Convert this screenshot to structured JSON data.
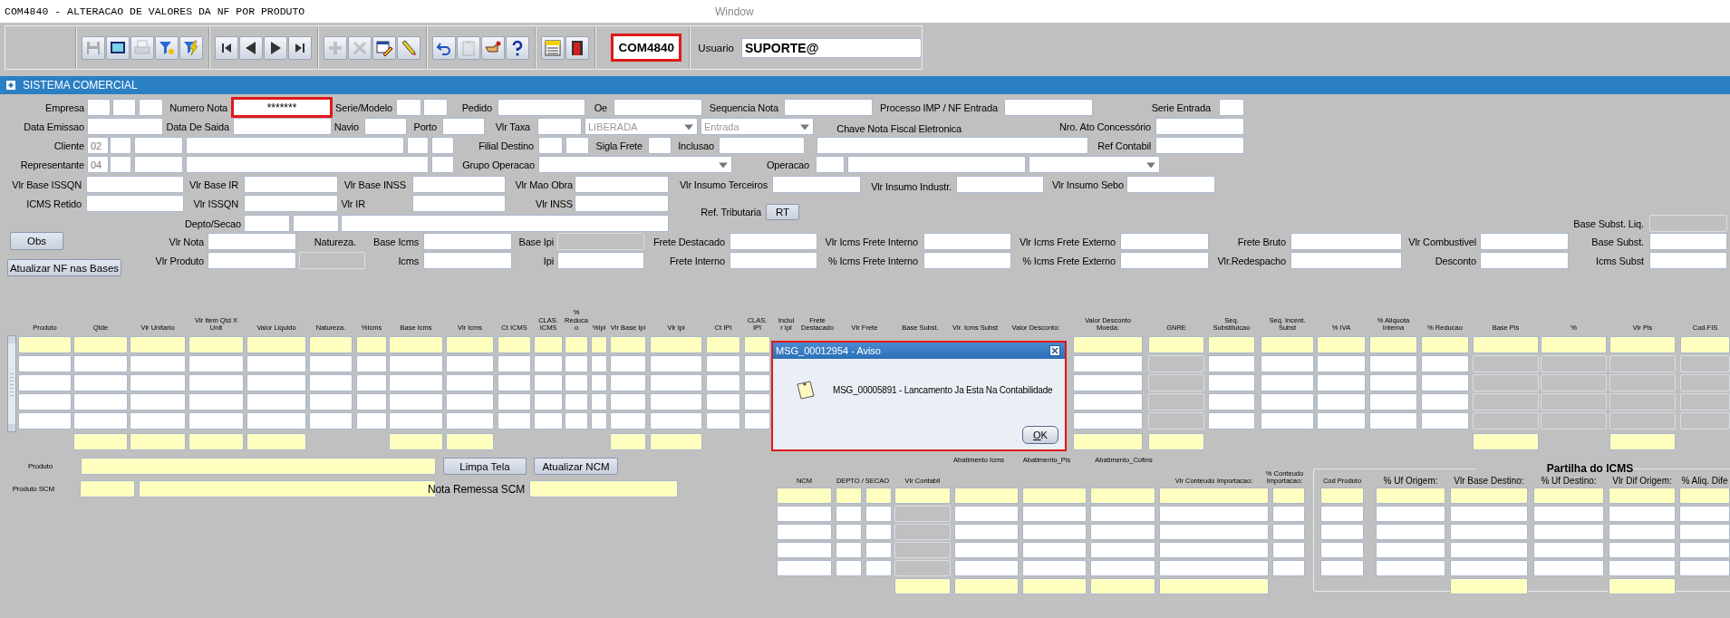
{
  "window": {
    "title": "COM4840 - ALTERACAO DE VALORES DA NF POR PRODUTO",
    "menu": "Window"
  },
  "toolbar": {
    "groups": [
      [
        {
          "kind": "save",
          "disabled": true
        },
        {
          "kind": "window",
          "disabled": false
        },
        {
          "kind": "print",
          "disabled": true
        },
        {
          "kind": "query",
          "disabled": false
        },
        {
          "kind": "execute",
          "disabled": false
        }
      ],
      [
        {
          "kind": "first",
          "disabled": false
        },
        {
          "kind": "prev",
          "disabled": false
        },
        {
          "kind": "next",
          "disabled": false
        },
        {
          "kind": "last",
          "disabled": false
        }
      ],
      [
        {
          "kind": "insert",
          "disabled": true
        },
        {
          "kind": "delete",
          "disabled": true
        },
        {
          "kind": "edit",
          "disabled": false
        },
        {
          "kind": "clear",
          "disabled": false
        }
      ],
      [
        {
          "kind": "undo",
          "disabled": false
        },
        {
          "kind": "clipboard",
          "disabled": true
        },
        {
          "kind": "hand",
          "disabled": false
        },
        {
          "kind": "help",
          "disabled": false
        }
      ],
      [
        {
          "kind": "menu",
          "disabled": false
        },
        {
          "kind": "exit",
          "disabled": false
        }
      ]
    ],
    "form_code": "COM4840",
    "user_label": "Usuario",
    "user": "SUPORTE@"
  },
  "panel": {
    "title": "SISTEMA COMERCIAL"
  },
  "form": {
    "rows": [
      {
        "items": [
          {
            "kind": "label",
            "text": "Empresa"
          },
          {
            "kind": "field",
            "disabled": false
          },
          {
            "kind": "field",
            "disabled": false
          },
          {
            "kind": "field",
            "disabled": false
          },
          {
            "kind": "label",
            "text": "Numero Nota"
          },
          {
            "kind": "field",
            "value": "*******",
            "disabled": false,
            "highlighted": true
          },
          {
            "kind": "label",
            "text": "Serie/Modelo"
          },
          {
            "kind": "field",
            "disabled": false
          },
          {
            "kind": "field",
            "disabled": false
          },
          {
            "kind": "label",
            "text": "Pedido"
          },
          {
            "kind": "field",
            "disabled": false
          },
          {
            "kind": "label",
            "text": "Oe"
          },
          {
            "kind": "field",
            "disabled": false
          },
          {
            "kind": "label",
            "text": "Sequencia Nota"
          },
          {
            "kind": "field",
            "disabled": false
          },
          {
            "kind": "label",
            "text": "Processo IMP / NF Entrada"
          },
          {
            "kind": "field",
            "disabled": false
          },
          {
            "kind": "label",
            "text": "Serie Entrada"
          },
          {
            "kind": "field",
            "disabled": false
          }
        ]
      },
      {
        "items": [
          {
            "kind": "label",
            "text": "Data Emissao"
          },
          {
            "kind": "field",
            "disabled": false
          },
          {
            "kind": "label",
            "text": "Data De Saida"
          },
          {
            "kind": "field",
            "disabled": false
          },
          {
            "kind": "label",
            "text": "Navio"
          },
          {
            "kind": "field",
            "disabled": false
          },
          {
            "kind": "label",
            "text": "Porto"
          },
          {
            "kind": "field",
            "disabled": false
          },
          {
            "kind": "label",
            "text": "Vlr Taxa"
          },
          {
            "kind": "field",
            "disabled": false
          },
          {
            "kind": "select",
            "value": "LIBERADA",
            "disabled": true
          },
          {
            "kind": "select",
            "value": "Entrada",
            "disabled": true
          },
          {
            "kind": "label",
            "text": "Chave Nota Fiscal Eletronica"
          },
          {
            "kind": "label",
            "text": "Nro. Ato Concessório"
          },
          {
            "kind": "field",
            "disabled": false
          }
        ]
      },
      {
        "items": [
          {
            "kind": "label",
            "text": "Cliente"
          },
          {
            "kind": "field",
            "value": "02",
            "disabled": false,
            "readonly": true
          },
          {
            "kind": "field",
            "disabled": false
          },
          {
            "kind": "field",
            "disabled": false
          },
          {
            "kind": "field",
            "disabled": false
          },
          {
            "kind": "field",
            "disabled": false
          },
          {
            "kind": "field",
            "disabled": false
          },
          {
            "kind": "label",
            "text": "Filial Destino"
          },
          {
            "kind": "field",
            "disabled": false
          },
          {
            "kind": "field",
            "disabled": false
          },
          {
            "kind": "label",
            "text": "Sigla Frete"
          },
          {
            "kind": "field",
            "disabled": false
          },
          {
            "kind": "label",
            "text": "Inclusao"
          },
          {
            "kind": "field",
            "disabled": false
          },
          {
            "kind": "field",
            "disabled": false
          },
          {
            "kind": "label",
            "text": "Ref Contabil"
          },
          {
            "kind": "field",
            "disabled": false
          }
        ]
      },
      {
        "items": [
          {
            "kind": "label",
            "text": "Representante"
          },
          {
            "kind": "field",
            "value": "04",
            "disabled": false,
            "readonly": true
          },
          {
            "kind": "field",
            "disabled": false
          },
          {
            "kind": "field",
            "disabled": false
          },
          {
            "kind": "field",
            "disabled": false
          },
          {
            "kind": "field",
            "disabled": false
          },
          {
            "kind": "label",
            "text": "Grupo Operacao"
          },
          {
            "kind": "select"
          },
          {
            "kind": "label",
            "text": "Operacao"
          },
          {
            "kind": "field",
            "disabled": false
          },
          {
            "kind": "field",
            "disabled": false
          },
          {
            "kind": "select"
          }
        ]
      },
      {
        "items": [
          {
            "kind": "label",
            "text": "Vlr Base ISSQN"
          },
          {
            "kind": "field",
            "disabled": false
          },
          {
            "kind": "label",
            "text": "Vlr Base IR"
          },
          {
            "kind": "field",
            "disabled": false
          },
          {
            "kind": "label",
            "text": "Vlr Base INSS"
          },
          {
            "kind": "field",
            "disabled": false
          },
          {
            "kind": "label",
            "text": "Vlr Mao Obra"
          },
          {
            "kind": "field",
            "disabled": false
          },
          {
            "kind": "label",
            "text": "Vlr Insumo Terceiros"
          },
          {
            "kind": "field",
            "disabled": false
          },
          {
            "kind": "label",
            "text": "Vlr Insumo Industr."
          },
          {
            "kind": "field",
            "disabled": false
          },
          {
            "kind": "label",
            "text": "Vlr Insumo Sebo"
          },
          {
            "kind": "field",
            "disabled": false
          }
        ]
      },
      {
        "items": [
          {
            "kind": "label",
            "text": "ICMS Retido"
          },
          {
            "kind": "field",
            "disabled": false
          },
          {
            "kind": "label",
            "text": "Vlr ISSQN"
          },
          {
            "kind": "field",
            "disabled": false
          },
          {
            "kind": "label",
            "text": "Vlr IR"
          },
          {
            "kind": "field",
            "disabled": false
          },
          {
            "kind": "label",
            "text": "Vlr INSS"
          },
          {
            "kind": "field",
            "disabled": false
          },
          {
            "kind": "label",
            "text": "Ref. Tributaria"
          },
          {
            "kind": "button",
            "text": "RT"
          }
        ]
      },
      {
        "items": [
          {
            "kind": "label",
            "text": "Depto/Secao"
          },
          {
            "kind": "field",
            "disabled": false
          },
          {
            "kind": "field",
            "disabled": false
          },
          {
            "kind": "field",
            "disabled": false
          },
          {
            "kind": "label",
            "text": "Base Subst. Liq."
          },
          {
            "kind": "field",
            "disabled": true
          }
        ]
      },
      {
        "items": [
          {
            "kind": "button",
            "text": "Obs"
          },
          {
            "kind": "label",
            "text": "Vlr Nota"
          },
          {
            "kind": "field",
            "disabled": false
          },
          {
            "kind": "label",
            "text": "Natureza."
          },
          {
            "kind": "label",
            "text": "Base Icms"
          },
          {
            "kind": "field",
            "disabled": false
          },
          {
            "kind": "label",
            "text": "Base Ipi"
          },
          {
            "kind": "field",
            "disabled": true
          },
          {
            "kind": "label",
            "text": "Frete Destacado"
          },
          {
            "kind": "field",
            "disabled": false
          },
          {
            "kind": "label",
            "text": "Vlr Icms Frete Interno"
          },
          {
            "kind": "field",
            "disabled": false
          },
          {
            "kind": "label",
            "text": "Vlr Icms Frete Externo"
          },
          {
            "kind": "field",
            "disabled": false
          },
          {
            "kind": "label",
            "text": "Frete Bruto"
          },
          {
            "kind": "field",
            "disabled": false
          },
          {
            "kind": "label",
            "text": "Vlr Combustivel"
          },
          {
            "kind": "field",
            "disabled": false
          },
          {
            "kind": "label",
            "text": "Base Subst."
          },
          {
            "kind": "field",
            "disabled": false
          }
        ]
      },
      {
        "items": [
          {
            "kind": "button",
            "text": "Atualizar NF nas Bases"
          },
          {
            "kind": "label",
            "text": "Vlr Produto"
          },
          {
            "kind": "field",
            "disabled": false
          },
          {
            "kind": "field",
            "disabled": true
          },
          {
            "kind": "label",
            "text": "Icms"
          },
          {
            "kind": "field",
            "disabled": false
          },
          {
            "kind": "label",
            "text": "Ipi"
          },
          {
            "kind": "field",
            "disabled": false
          },
          {
            "kind": "label",
            "text": "Frete Interno"
          },
          {
            "kind": "field",
            "disabled": false
          },
          {
            "kind": "label",
            "text": "% Icms Frete Interno"
          },
          {
            "kind": "field",
            "disabled": false
          },
          {
            "kind": "label",
            "text": "% Icms Frete Externo"
          },
          {
            "kind": "field",
            "disabled": false
          },
          {
            "kind": "label",
            "text": "Vlr.Redespacho"
          },
          {
            "kind": "field",
            "disabled": false
          },
          {
            "kind": "label",
            "text": "Desconto"
          },
          {
            "kind": "field",
            "disabled": false
          },
          {
            "kind": "label",
            "text": "Icms Subst"
          },
          {
            "kind": "field",
            "disabled": false
          }
        ]
      }
    ]
  },
  "items_table": {
    "columns": [
      {
        "header": "Produto",
        "disabled": false,
        "total": false
      },
      {
        "header": "Qtde",
        "disabled": false,
        "total": true
      },
      {
        "header": "Vlr Unitario",
        "disabled": false,
        "total": true
      },
      {
        "header": "Vlr Item Qtd X Unit",
        "disabled": false,
        "total": true
      },
      {
        "header": "Valor Liquido",
        "disabled": false,
        "total": true
      },
      {
        "header": "Natureza.",
        "disabled": false,
        "total": false
      },
      {
        "header": "%Icms",
        "disabled": false,
        "total": false
      },
      {
        "header": "Base Icms",
        "disabled": false,
        "total": true
      },
      {
        "header": "Vlr Icms",
        "disabled": false,
        "total": true
      },
      {
        "header": "Ct ICMS",
        "disabled": false,
        "total": false
      },
      {
        "header": "CLAS. ICMS",
        "disabled": false,
        "total": false
      },
      {
        "header": "% Reducao",
        "disabled": false,
        "total": false
      },
      {
        "header": "%Ipi",
        "disabled": false,
        "total": false
      },
      {
        "header": "Vlr Base Ipi",
        "disabled": false,
        "total": true
      },
      {
        "header": "Vlr Ipi",
        "disabled": false,
        "total": true
      },
      {
        "header": "Ct IPI",
        "disabled": false,
        "total": false
      },
      {
        "header": "CLAS. IPI",
        "disabled": false,
        "total": false
      },
      {
        "header": "Incluir Ipi"
      },
      {
        "header": "Frete Destacado"
      },
      {
        "header": "Vlr Frete"
      },
      {
        "header": "Base Subst."
      },
      {
        "header": "Vlr. Icms Subst"
      },
      {
        "header": "Valor Desconto:"
      },
      {
        "header": "Valor Desconto Moeda:",
        "disabled": false,
        "total": true
      },
      {
        "header": "GNRE",
        "disabled": true,
        "total": true
      },
      {
        "header": "Seq. Substituicao",
        "disabled": false,
        "total": false
      },
      {
        "header": "Seq. Incent. Subst",
        "disabled": false,
        "total": false
      },
      {
        "header": "% IVA",
        "disabled": false,
        "total": false
      },
      {
        "header": "% Aliquota Interna",
        "disabled": false,
        "total": false
      },
      {
        "header": "% Reducao",
        "disabled": false,
        "total": false
      },
      {
        "header": "Base Pis",
        "disabled": true,
        "total": true
      },
      {
        "header": "%",
        "disabled": true,
        "total": false
      },
      {
        "header": "Vlr Pis",
        "disabled": true,
        "total": true
      },
      {
        "header": "Cod.FIS",
        "disabled": true,
        "total": false
      }
    ],
    "rows": [
      {
        "selected": true
      },
      {
        "selected": false
      },
      {
        "selected": false
      },
      {
        "selected": false
      },
      {
        "selected": false
      }
    ]
  },
  "product_rows": [
    {
      "items": [
        {
          "kind": "label",
          "text": "Produto"
        },
        {
          "kind": "field",
          "required": true
        },
        {
          "kind": "button",
          "text": "Limpa Tela"
        },
        {
          "kind": "button",
          "text": "Atualizar NCM"
        }
      ]
    },
    {
      "items": [
        {
          "kind": "label",
          "text": "Produto SCM"
        },
        {
          "kind": "field",
          "required": true
        },
        {
          "kind": "field",
          "required": true
        },
        {
          "kind": "label",
          "text": "Nota Remessa SCM"
        },
        {
          "kind": "field",
          "required": true
        }
      ]
    }
  ],
  "ncm_table": {
    "headers": [
      "NCM",
      "DEPTO / SECAO",
      "Vlr Contabil",
      "Abatimento Icms",
      "Abatimento_Pis",
      "Abatimento_Cofins",
      "Vlr Conteudo Importacao:",
      "% Conteudo Importacao:"
    ],
    "columns": [
      {
        "disabled": false,
        "total": false
      },
      {
        "disabled": false,
        "total": false
      },
      {
        "disabled": false,
        "total": false
      },
      {
        "disabled": true,
        "total": true
      },
      {
        "disabled": false,
        "total": true
      },
      {
        "disabled": false,
        "total": true
      },
      {
        "disabled": false,
        "total": true
      },
      {
        "disabled": false,
        "total": true
      },
      {
        "disabled": false,
        "total": false
      }
    ],
    "rows": [
      {
        "selected": true
      },
      {
        "selected": false
      },
      {
        "selected": false
      },
      {
        "selected": false
      },
      {
        "selected": false
      }
    ]
  },
  "partilha": {
    "title": "Partilha do ICMS",
    "columns": [
      {
        "header": "Cod Produto",
        "total": false
      },
      {
        "header": "% Uf Origem:",
        "total": false
      },
      {
        "header": "Vlr Base Destino:",
        "total": true
      },
      {
        "header": "% Uf Destino:",
        "total": false
      },
      {
        "header": "Vlr Dif Origem:",
        "total": true
      },
      {
        "header": "% Aliq. Dife",
        "total": false
      }
    ],
    "rows": [
      {
        "selected": true
      },
      {
        "selected": false
      },
      {
        "selected": false
      },
      {
        "selected": false
      },
      {
        "selected": false
      }
    ]
  },
  "dialog": {
    "title": "MSG_00012954 - Aviso",
    "message": "MSG_00005891 - Lancamento Ja Esta Na Contabilidade",
    "button": "OK"
  }
}
